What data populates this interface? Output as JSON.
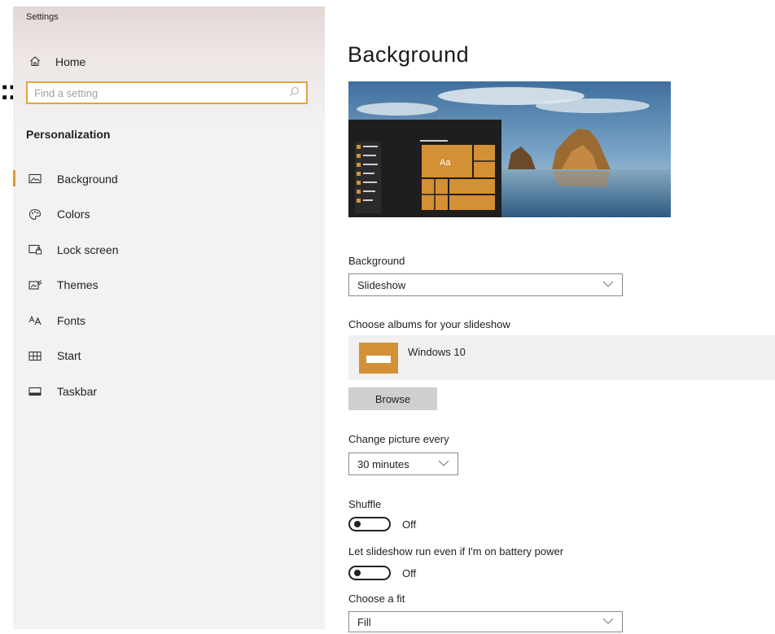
{
  "window": {
    "title": "Settings"
  },
  "artifact": {
    "stray_text": "::"
  },
  "sidebar": {
    "home_label": "Home",
    "search": {
      "placeholder": "Find a setting"
    },
    "section_title": "Personalization",
    "items": [
      {
        "label": "Background",
        "icon": "picture-icon",
        "active": true
      },
      {
        "label": "Colors",
        "icon": "palette-icon",
        "active": false
      },
      {
        "label": "Lock screen",
        "icon": "lock-screen-icon",
        "active": false
      },
      {
        "label": "Themes",
        "icon": "themes-icon",
        "active": false
      },
      {
        "label": "Fonts",
        "icon": "fonts-icon",
        "active": false
      },
      {
        "label": "Start",
        "icon": "start-icon",
        "active": false
      },
      {
        "label": "Taskbar",
        "icon": "taskbar-icon",
        "active": false
      }
    ]
  },
  "main": {
    "title": "Background",
    "preview": {
      "sample_text": "Aa"
    },
    "background_label": "Background",
    "background_value": "Slideshow",
    "albums_label": "Choose albums for your slideshow",
    "album_name": "Windows 10",
    "browse_label": "Browse",
    "change_label": "Change picture every",
    "change_value": "30 minutes",
    "shuffle_label": "Shuffle",
    "shuffle_state": "Off",
    "battery_label": "Let slideshow run even if I'm on battery power",
    "battery_state": "Off",
    "fit_label": "Choose a fit",
    "fit_value": "Fill"
  },
  "colors": {
    "accent": "#e09a36",
    "tile": "#d49035",
    "sidebar": "#f2f2f2",
    "search_border": "#e7a142"
  }
}
